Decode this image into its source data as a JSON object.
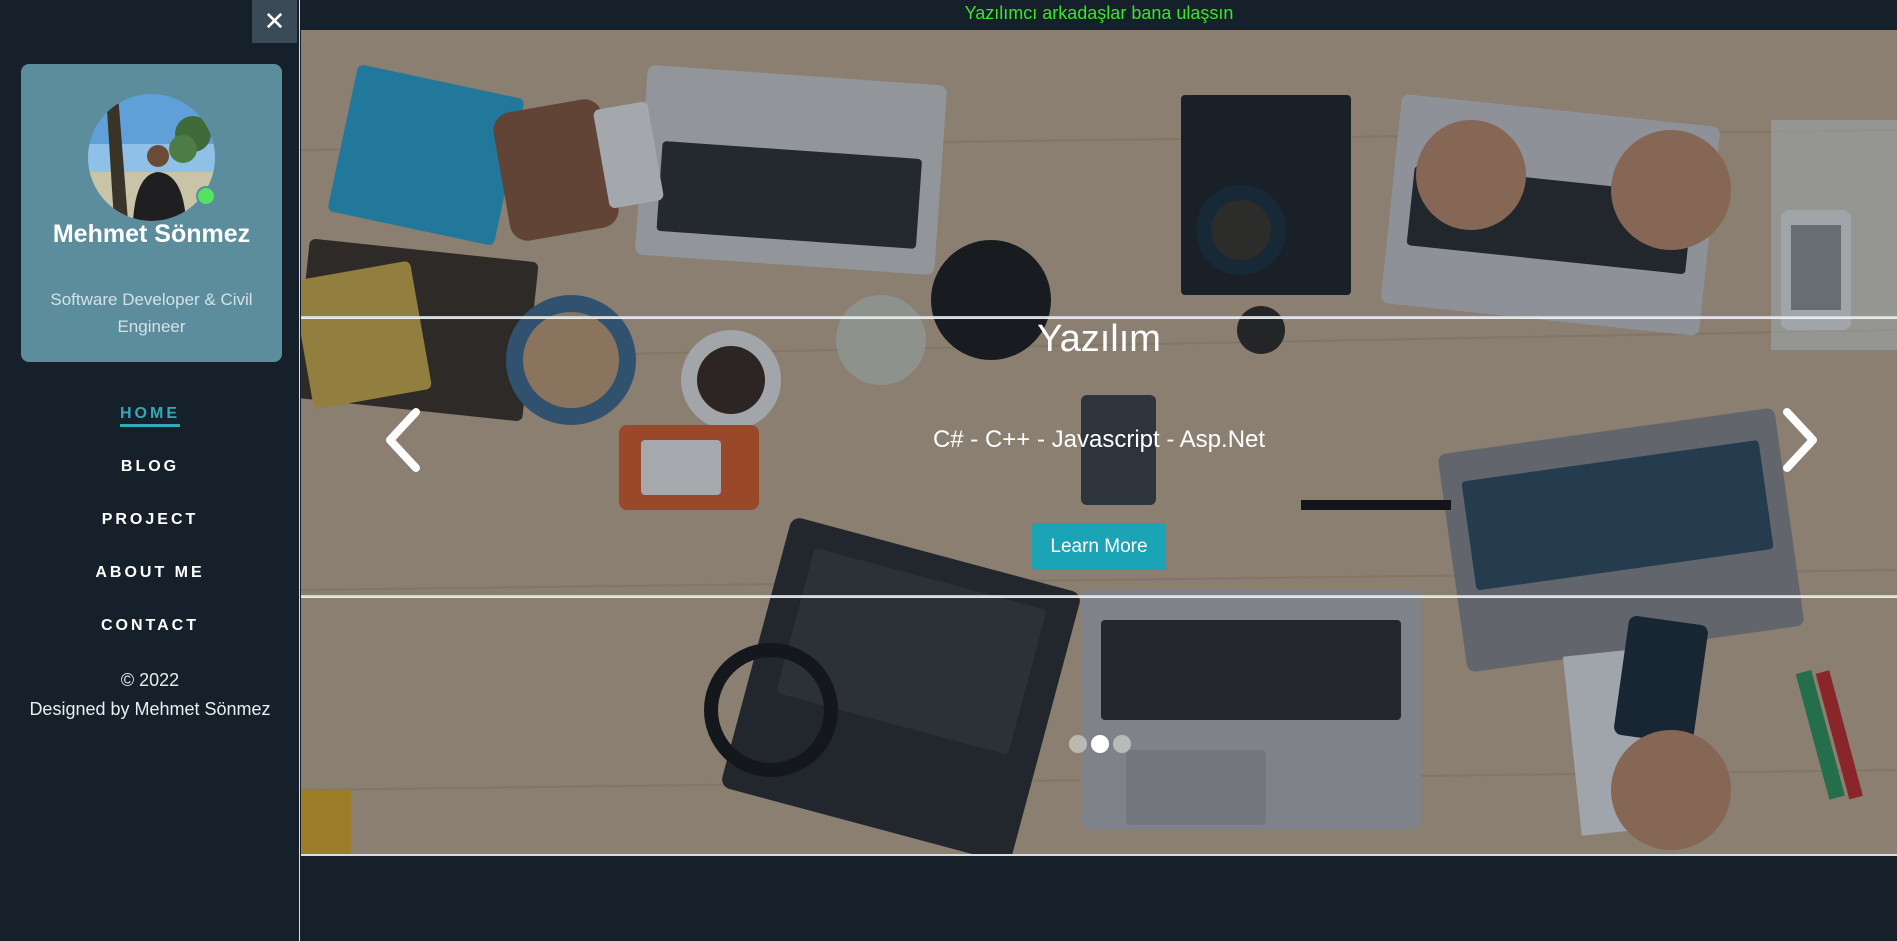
{
  "topbar": {
    "message": "Yazılımcı arkadaşlar bana ulaşsın"
  },
  "sidebar": {
    "close_label": "✕",
    "profile": {
      "name": "Mehmet Sönmez",
      "role": "Software Developer & Civil Engineer",
      "status": "online"
    },
    "nav": [
      {
        "label": "HOME",
        "active": true
      },
      {
        "label": "BLOG",
        "active": false
      },
      {
        "label": "PROJECT",
        "active": false
      },
      {
        "label": "ABOUT ME",
        "active": false
      },
      {
        "label": "CONTACT",
        "active": false
      }
    ],
    "footer": {
      "copyright": "© 2022",
      "credit": "Designed by Mehmet Sönmez"
    }
  },
  "carousel": {
    "title": "Yazılım",
    "subtitle": "C# - C++ - Javascript - Asp.Net",
    "button_label": "Learn More",
    "slide_count": 3,
    "active_slide": 2,
    "prev_icon": "chevron-left-icon",
    "next_icon": "chevron-right-icon"
  },
  "colors": {
    "background": "#15202b",
    "card": "#5b8d9c",
    "accent": "#1ba3b6",
    "active_nav": "#34a9b7",
    "topbar_text": "#39e628",
    "online": "#54e35c"
  }
}
